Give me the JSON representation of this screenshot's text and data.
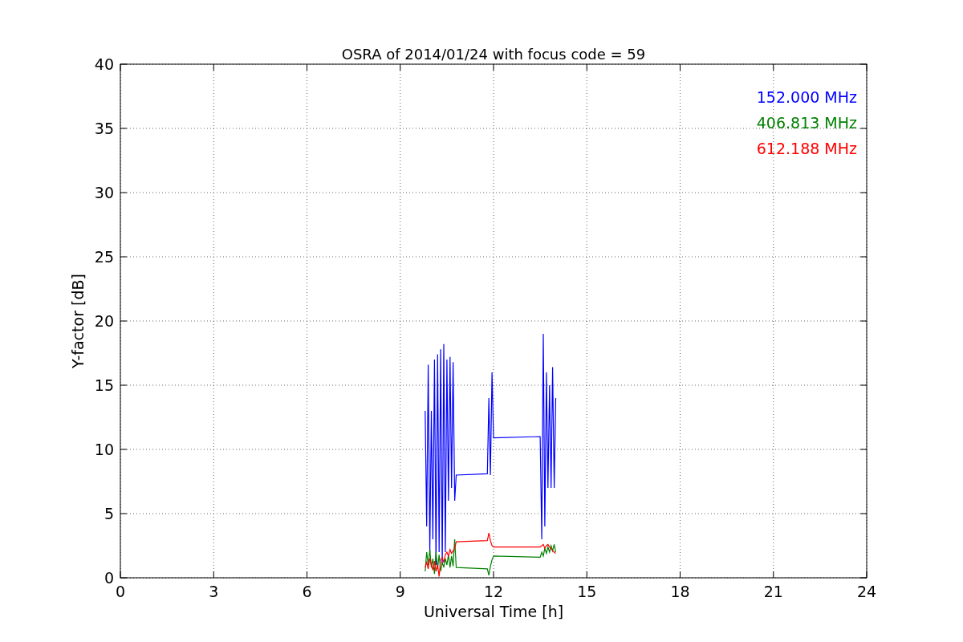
{
  "chart_data": {
    "type": "line",
    "title": "OSRA of 2014/01/24 with focus code = 59",
    "xlabel": "Universal Time [h]",
    "ylabel": "Y-factor [dB]",
    "x": [
      9.8,
      9.85,
      9.9,
      9.95,
      10.0,
      10.05,
      10.1,
      10.15,
      10.2,
      10.25,
      10.3,
      10.35,
      10.4,
      10.45,
      10.5,
      10.55,
      10.6,
      10.65,
      10.7,
      10.75,
      10.8,
      11.8,
      11.85,
      11.9,
      11.95,
      12.0,
      13.5,
      13.55,
      13.6,
      13.65,
      13.7,
      13.75,
      13.8,
      13.85,
      13.9,
      13.95,
      14.0
    ],
    "series": [
      {
        "name": "152.000 MHz",
        "color": "#0000ff",
        "values": [
          13,
          4,
          16.6,
          2,
          13,
          3,
          17,
          1,
          17.4,
          2,
          17.8,
          1,
          18.2,
          2,
          17,
          6,
          17.2,
          7,
          16.8,
          6,
          8,
          8.1,
          14,
          8,
          16,
          10.9,
          11,
          3,
          19,
          4,
          16,
          7,
          15,
          7,
          16.4,
          7,
          14
        ]
      },
      {
        "name": "406.813 MHz",
        "color": "#008000",
        "values": [
          0.5,
          2,
          1,
          2.2,
          0.8,
          1.5,
          0.3,
          2,
          0.7,
          1.8,
          0.5,
          1.2,
          0.8,
          1.5,
          1,
          1.8,
          0.8,
          1.7,
          0.9,
          3,
          0.8,
          0.7,
          0.2,
          0.9,
          1.4,
          1.7,
          1.6,
          2,
          1.7,
          2.3,
          1.9,
          2.4,
          2,
          2.5,
          2.1,
          2.6,
          2
        ]
      },
      {
        "name": "612.188 MHz",
        "color": "#ff0000",
        "values": [
          0.8,
          1.2,
          0.7,
          1.5,
          1,
          0.6,
          1.3,
          0.5,
          1,
          0.1,
          1.4,
          1.6,
          1.2,
          1.8,
          2,
          1.7,
          2.2,
          1.9,
          2.1,
          2.3,
          2.8,
          2.9,
          3.5,
          2.9,
          2.5,
          2.4,
          2.4,
          2.5,
          2.6,
          2.3,
          2.5,
          2.6,
          2.4,
          2.3,
          2.1,
          2,
          1.9
        ]
      }
    ],
    "grid": true,
    "xlim": [
      0,
      24
    ],
    "ylim": [
      0,
      40
    ],
    "xticks": [
      0,
      3,
      6,
      9,
      12,
      15,
      18,
      21,
      24
    ],
    "yticks": [
      0,
      5,
      10,
      15,
      20,
      25,
      30,
      35,
      40
    ]
  }
}
